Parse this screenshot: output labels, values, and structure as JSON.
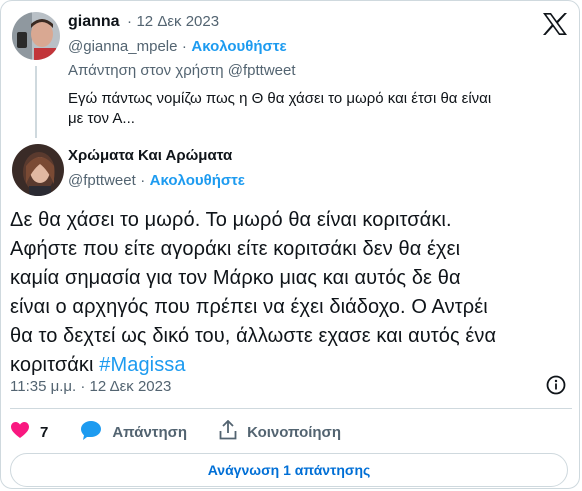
{
  "reply_tweet": {
    "author_name": "gianna",
    "separator": "·",
    "date": "12 Δεκ 2023",
    "handle": "@gianna_mpele",
    "follow_label": "Ακολουθήστε",
    "reply_context": "Απάντηση στον χρήστη @fpttweet",
    "text_line1": "Εγώ πάντως νομίζω πως η Θ θα χάσει το μωρό και έτσι θα είναι",
    "text_line2": "με τον Α..."
  },
  "main_tweet": {
    "author_name": "Χρώματα Και Αρώματα",
    "handle": "@fpttweet",
    "separator": "·",
    "follow_label": "Ακολουθήστε",
    "text_lines": [
      "Δε θα χάσει το μωρό. Το μωρό θα είναι κοριτσάκι.",
      "Αφήστε που είτε αγοράκι είτε κοριτσάκι δεν θα έχει",
      "καμία σημασία για τον Μάρκο μιας και αυτός δε θα",
      "είναι ο αρχηγός που πρέπει να έχει διάδοχο. Ο Αντρέι",
      "θα το δεχτεί ως δικό του, άλλωστε εχασε και αυτός ένα",
      "κοριτσάκι "
    ],
    "hashtag": "#Magissa",
    "timestamp": "11:35 μ.μ. · 12 Δεκ 2023"
  },
  "actions": {
    "like_count": "7",
    "reply_label": "Απάντηση",
    "share_label": "Κοινοποίηση"
  },
  "read_replies_label": "Ανάγνωση 1 απάντησης",
  "colors": {
    "accent": "#1d9bf0",
    "like": "#f91880",
    "muted": "#536471",
    "border": "#cfd9de"
  },
  "icons": [
    "x-logo-icon",
    "info-icon",
    "heart-icon",
    "reply-bubble-icon",
    "share-icon"
  ]
}
